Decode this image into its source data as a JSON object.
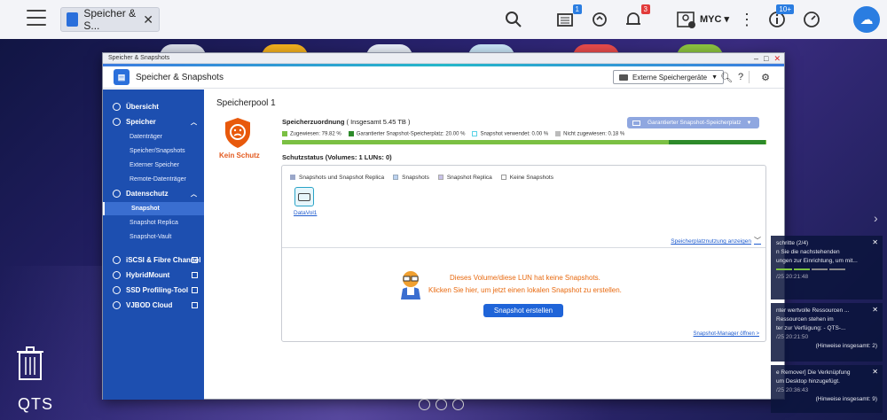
{
  "taskbar": {
    "tab_title": "Speicher & S...",
    "user": "MYC",
    "badges": {
      "tasks": "1",
      "notifications": "3",
      "dashboard": "10+"
    },
    "icons": [
      "menu-icon",
      "search-icon",
      "tasks-icon",
      "sync-icon",
      "bell-icon",
      "user-icon",
      "more-icon",
      "info-icon",
      "gauge-icon",
      "cloud-icon"
    ]
  },
  "desktop": {
    "brand": "QTS"
  },
  "window": {
    "title": "Speicher & Snapshots",
    "app_name": "Speicher & Snapshots",
    "ext_button": "Externe Speichergeräte"
  },
  "sidebar": {
    "overview": "Übersicht",
    "storage": "Speicher",
    "storage_items": [
      "Datenträger",
      "Speicher/Snapshots",
      "Externer Speicher",
      "Remote-Datenträger"
    ],
    "protection": "Datenschutz",
    "protection_items": [
      "Snapshot",
      "Snapshot Replica",
      "Snapshot-Vault"
    ],
    "links": [
      "iSCSI & Fibre Channel",
      "HybridMount",
      "SSD Profiling-Tool",
      "VJBOD Cloud"
    ]
  },
  "main": {
    "pool_title": "Speicherpool 1",
    "protection_state": "Kein Schutz",
    "alloc_title": "Speicherzuordnung",
    "alloc_total": "( Insgesamt 5.45 TB )",
    "guaranteed_pool_btn": "Garantierter Snapshot-Speicherplatz",
    "legend": [
      {
        "label": "Zugewiesen: 79.82 %",
        "color": "#7bc043"
      },
      {
        "label": "Garantierter Snapshot-Speicherplatz: 20.00 %",
        "color": "#2d8a2a"
      },
      {
        "label": "Snapshot verwendet: 0.00 %",
        "color": "#5ad3e6"
      },
      {
        "label": "Nicht zugewiesen: 0.18 %",
        "color": "#bbbbbb"
      }
    ],
    "usage": {
      "allocated": 79.82,
      "guaranteed": 20.0,
      "used": 0.0,
      "unallocated": 0.18
    },
    "status_title": "Schutzstatus (Volumes: 1 LUNs: 0)",
    "filters": [
      {
        "label": "Snapshots und Snapshot Replica",
        "color": "#9aa7c9"
      },
      {
        "label": "Snapshots",
        "color": "#bcd2f0"
      },
      {
        "label": "Snapshot Replica",
        "color": "#c8c2e8"
      },
      {
        "label": "Keine Snapshots",
        "color": "#ffffff"
      }
    ],
    "volume_name": "DataVol1",
    "usage_link": "Speicherplatznutzung anzeigen",
    "no_snapshot_line1": "Dieses Volume/diese LUN hat keine Snapshots.",
    "no_snapshot_line2": "Klicken Sie hier, um jetzt einen lokalen Snapshot zu erstellen.",
    "create_button": "Snapshot erstellen",
    "manager_link": "Snapshot-Manager öffnen >"
  },
  "notifications": [
    {
      "title": "schritte (2/4)",
      "body": "n Sie die nachstehenden",
      "body2": "ungen zur Einrichtung, um mit...",
      "time": "/25 20:21:48"
    },
    {
      "title": "nter wertvolle Ressourcen ...",
      "body": "Ressourcen stehen im",
      "body2": "ter zur Verfügung: - QTS-...",
      "time": "/25 20:21:50",
      "hint": "(Hinweise insgesamt: 2)"
    },
    {
      "title": "e Remover] Die Verknüpfung",
      "body": "um Desktop hinzugefügt.",
      "time": "/25 20:36:43",
      "hint": "(Hinweise insgesamt: 9)"
    }
  ]
}
